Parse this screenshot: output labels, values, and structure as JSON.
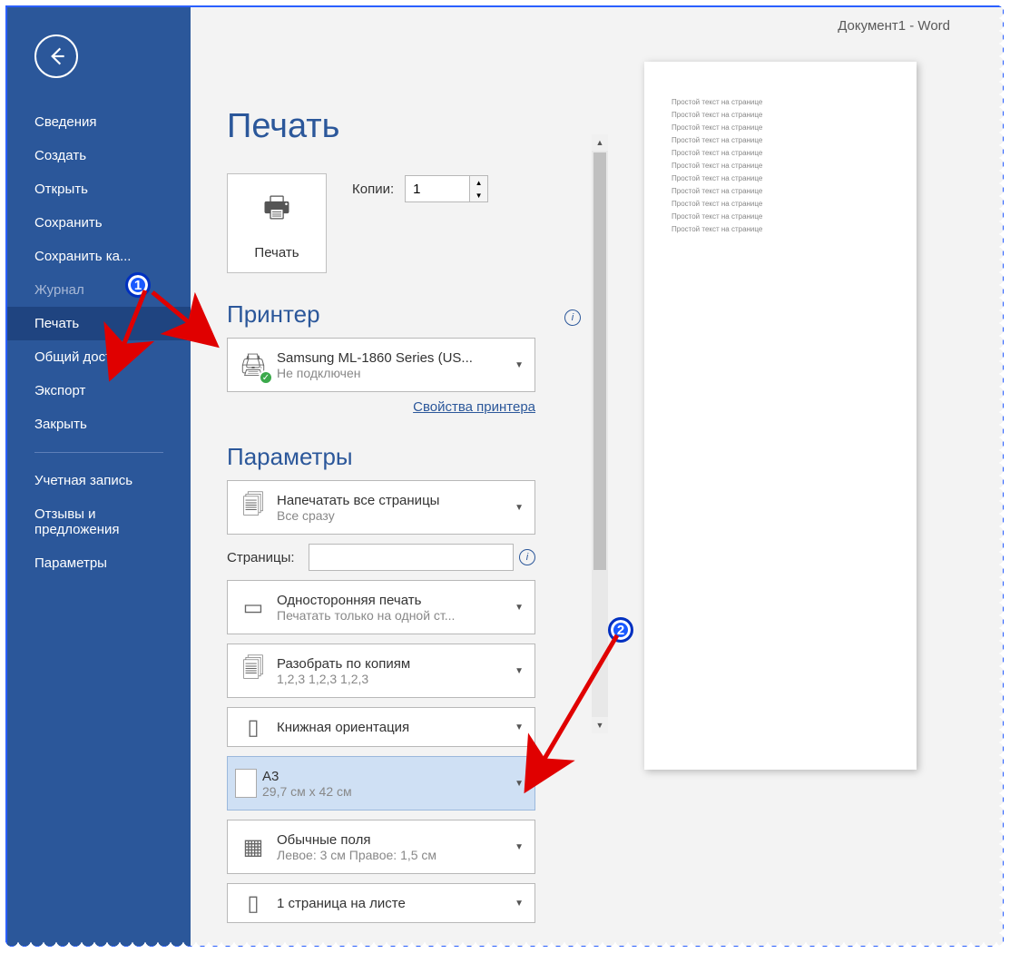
{
  "titlebar": "Документ1  -  Word",
  "sidebar": [
    {
      "label": "Сведения",
      "state": "normal"
    },
    {
      "label": "Создать",
      "state": "normal"
    },
    {
      "label": "Открыть",
      "state": "normal"
    },
    {
      "label": "Сохранить",
      "state": "normal"
    },
    {
      "label": "Сохранить ка...",
      "state": "normal"
    },
    {
      "label": "Журнал",
      "state": "disabled"
    },
    {
      "label": "Печать",
      "state": "active"
    },
    {
      "label": "Общий доступ",
      "state": "normal"
    },
    {
      "label": "Экспорт",
      "state": "normal"
    },
    {
      "label": "Закрыть",
      "state": "normal"
    }
  ],
  "sidebar2": [
    {
      "label": "Учетная запись"
    },
    {
      "label": "Отзывы и предложения"
    },
    {
      "label": "Параметры"
    }
  ],
  "heading": "Печать",
  "print_button_label": "Печать",
  "copies_label": "Копии:",
  "copies_value": "1",
  "printer_heading": "Принтер",
  "printer": {
    "name": "Samsung ML-1860 Series (US...",
    "status": "Не подключен"
  },
  "printer_properties_link": "Свойства принтера",
  "params_heading": "Параметры",
  "pages_field_label": "Страницы:",
  "options": {
    "range": {
      "t1": "Напечатать все страницы",
      "t2": "Все сразу"
    },
    "sides": {
      "t1": "Односторонняя печать",
      "t2": "Печатать только на одной ст..."
    },
    "collate": {
      "t1": "Разобрать по копиям",
      "t2": "1,2,3    1,2,3    1,2,3"
    },
    "orientation": {
      "t1": "Книжная ориентация"
    },
    "paper": {
      "t1": "A3",
      "t2": "29,7 см x 42 см"
    },
    "margins": {
      "t1": "Обычные поля",
      "t2": "Левое:  3 см    Правое:  1,5 см"
    },
    "sheets": {
      "t1": "1 страница на листе"
    }
  },
  "preview_line": "Простой текст на странице",
  "annotations": {
    "m1": "1",
    "m2": "2"
  }
}
